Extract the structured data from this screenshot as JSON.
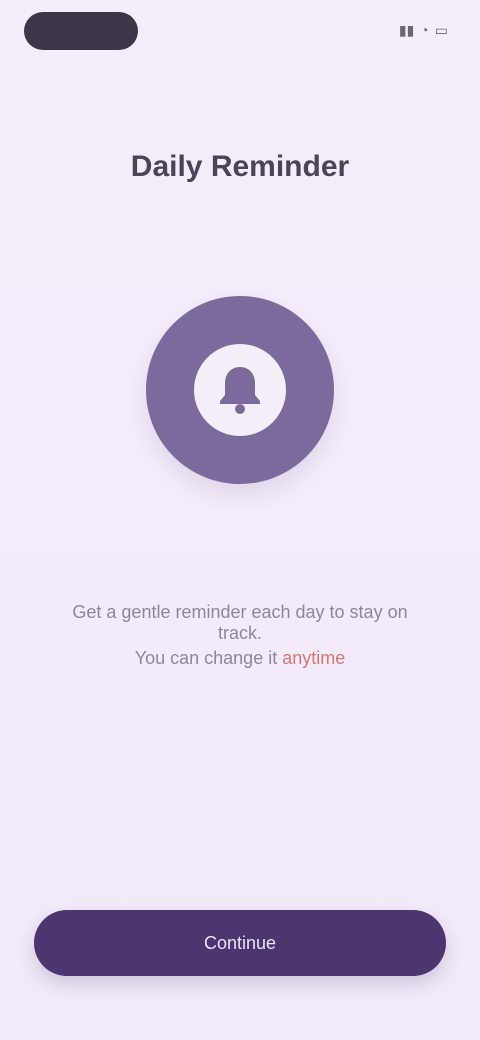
{
  "status": {
    "pill": "",
    "icons": [
      "signal-icon",
      "wifi-icon",
      "battery-icon"
    ]
  },
  "url": {
    "text": "",
    "action": ""
  },
  "title": "Daily Reminder",
  "description": {
    "line1": "Get a gentle reminder each day to stay on track.",
    "line2_main": "You can change it ",
    "line2_accent": "anytime"
  },
  "cta": {
    "label": "Continue"
  },
  "colors": {
    "background": "#f3ebf8",
    "accent": "#4b3670",
    "bell": "#7b6a9c"
  }
}
